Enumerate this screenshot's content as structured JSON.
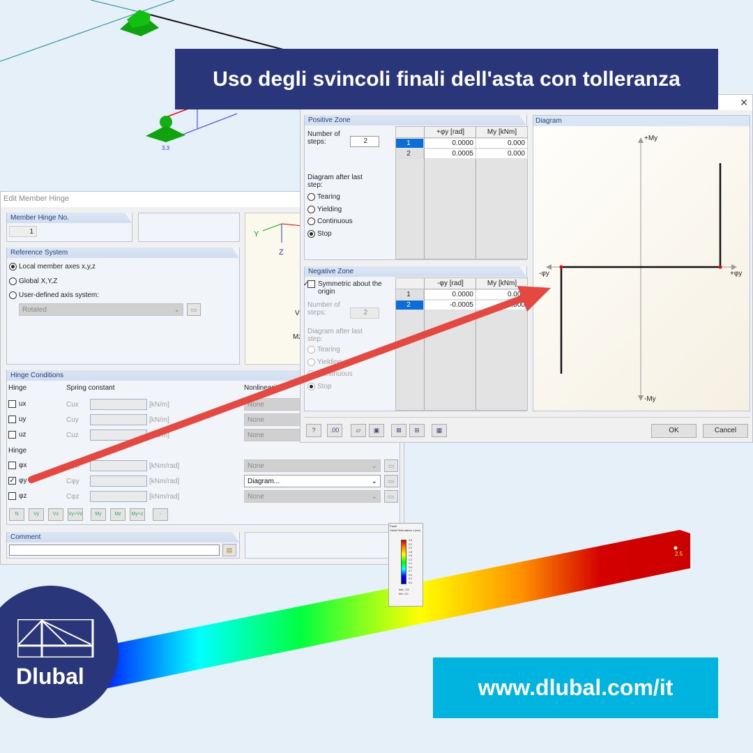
{
  "banner": {
    "title": "Uso degli svincoli finali dell'asta con tolleranza"
  },
  "url_box": {
    "text": "www.dlubal.com/it"
  },
  "logo": {
    "text": "Dlubal"
  },
  "model": {
    "support_label": "3.3",
    "beam_label": "2.5",
    "colors": [
      "#0000ff",
      "#00ffff",
      "#00ff00",
      "#ffff00",
      "#ff8000",
      "#d40000"
    ]
  },
  "edit_dialog": {
    "title": "Edit Member Hinge",
    "hinge_no": {
      "label": "Member Hinge No.",
      "value": "1"
    },
    "reference": {
      "label": "Reference System",
      "options": [
        {
          "label": "Local member axes x,y,z",
          "selected": true
        },
        {
          "label": "Global X,Y,Z",
          "selected": false
        },
        {
          "label": "User-defined axis system:",
          "selected": false
        }
      ],
      "axis_select": "Rotated"
    },
    "preview": {
      "y": "Y",
      "z": "Z",
      "vz": "Vz",
      "mz": "Mz"
    },
    "conditions": {
      "label": "Hinge Conditions",
      "hinge_header": "Hinge",
      "spring_header": "Spring constant",
      "nonlinear_header": "Nonlinearity",
      "translational": [
        {
          "name": "ux",
          "const": "Cux",
          "unit": "[kN/m]",
          "nonlinear": "None",
          "checked": false
        },
        {
          "name": "uy",
          "const": "Cuy",
          "unit": "[kN/m]",
          "nonlinear": "None",
          "checked": false
        },
        {
          "name": "uz",
          "const": "Cuz",
          "unit": "[kN/m]",
          "nonlinear": "None",
          "checked": false
        }
      ],
      "rotational_header": "Hinge",
      "rotational": [
        {
          "name": "φx",
          "const": "Cφx",
          "unit": "[kNm/rad]",
          "nonlinear": "None",
          "checked": false
        },
        {
          "name": "φy",
          "const": "Cφy",
          "unit": "[kNm/rad]",
          "nonlinear": "Diagram...",
          "checked": true
        },
        {
          "name": "φz",
          "const": "Cφz",
          "unit": "[kNm/rad]",
          "nonlinear": "None",
          "checked": false
        }
      ],
      "presets": [
        "N",
        "Vy",
        "Vz",
        "Vy+Vz",
        "My",
        "Mz",
        "My+z",
        "-"
      ]
    },
    "comment": {
      "label": "Comment",
      "value": ""
    }
  },
  "diagram_dialog": {
    "positive": {
      "label": "Positive Zone",
      "steps_label": "Number of steps:",
      "steps": "2",
      "after_label": "Diagram after last step:",
      "options": [
        {
          "label": "Tearing",
          "selected": false
        },
        {
          "label": "Yielding",
          "selected": false
        },
        {
          "label": "Continuous",
          "selected": false
        },
        {
          "label": "Stop",
          "selected": true
        }
      ],
      "columns": [
        "+φy [rad]",
        "My [kNm]"
      ],
      "rows": [
        [
          "1",
          "0.0000",
          "0.000"
        ],
        [
          "2",
          "0.0005",
          "0.000"
        ]
      ]
    },
    "negative": {
      "label": "Negative Zone",
      "symmetric_label": "Symmetric about the origin",
      "symmetric": true,
      "steps_label": "Number of steps:",
      "steps": "2",
      "after_label": "Diagram after last step:",
      "options": [
        {
          "label": "Tearing",
          "selected": false
        },
        {
          "label": "Yielding",
          "selected": false
        },
        {
          "label": "Continuous",
          "selected": false
        },
        {
          "label": "Stop",
          "selected": true
        }
      ],
      "columns": [
        "-φy [rad]",
        "My [kNm]"
      ],
      "rows": [
        [
          "1",
          "0.0000",
          "0.000"
        ],
        [
          "2",
          "-0.0005",
          "0.000"
        ]
      ]
    },
    "diagram": {
      "label": "Diagram",
      "top": "+My",
      "bottom": "-My",
      "left": "-φy",
      "right": "+φy"
    },
    "ok": "OK",
    "cancel": "Cancel"
  },
  "panel": {
    "title": "Panel",
    "subtitle": "Global Deformations u [mm]",
    "scale": [
      "2.5",
      "2.2",
      "2.0",
      "1.8",
      "1.6",
      "1.3",
      "1.1",
      "0.9",
      "0.7",
      "0.4",
      "0.2",
      "0.0"
    ],
    "max": "Max : 2.5",
    "min": "Min : 0.0"
  }
}
